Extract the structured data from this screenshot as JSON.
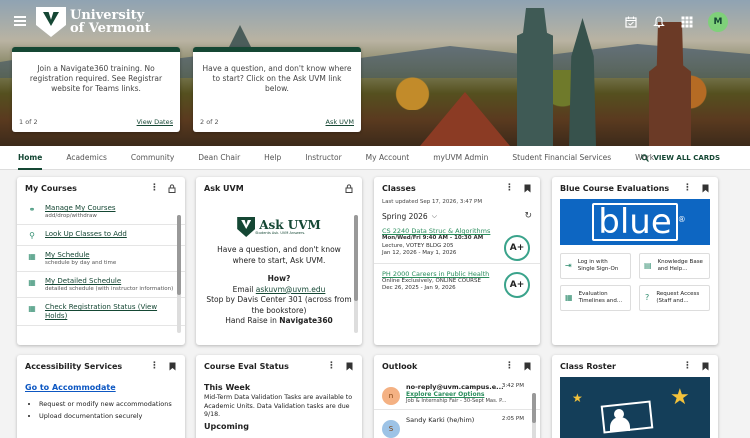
{
  "header": {
    "logo_line1": "University",
    "logo_line2": "of Vermont",
    "avatar_initial": "M"
  },
  "promos": [
    {
      "message": "Join a Navigate360 training. No registration required. See Registrar website for Teams links.",
      "pager": "1 of 2",
      "link": "View Dates"
    },
    {
      "message": "Have a question, and don't know where to start? Click on the Ask UVM link below.",
      "pager": "2 of 2",
      "link": "Ask UVM"
    }
  ],
  "nav": {
    "items": [
      "Home",
      "Academics",
      "Community",
      "Dean Chair",
      "Help",
      "Instructor",
      "My Account",
      "myUVM Admin",
      "Student Financial Services",
      "Work"
    ],
    "view_all": "VIEW ALL CARDS"
  },
  "my_courses": {
    "title": "My Courses",
    "items": [
      {
        "label": "Manage My Courses",
        "sub": "add/drop/withdraw",
        "icon": "share-icon"
      },
      {
        "label": "Look Up Classes to Add",
        "sub": "",
        "icon": "search-icon"
      },
      {
        "label": "My Schedule",
        "sub": "schedule by day and time",
        "icon": "calendar-icon"
      },
      {
        "label": "My Detailed Schedule",
        "sub": "detailed schedule (with instructor information)",
        "icon": "calendar-icon"
      },
      {
        "label": "Check Registration Status (View Holds)",
        "sub": "",
        "icon": "calendar-icon"
      }
    ]
  },
  "ask_uvm": {
    "title": "Ask UVM",
    "logo_name": "Ask UVM",
    "logo_tag": "Students Ask. UVM Answers.",
    "question": "Have a question, and don't know where to start, Ask UVM.",
    "how": "How?",
    "email_label": "Email",
    "email": "askuvm@uvm.edu",
    "stop_by": "Stop by Davis Center 301 (across from the bookstore)",
    "hand_raise": "Hand Raise in",
    "hand_raise_bold": "Navigate360"
  },
  "classes": {
    "title": "Classes",
    "updated": "Last updated Sep 17, 2026, 3:47 PM",
    "term": "Spring 2026",
    "entries": [
      {
        "code": "CS 2240 Data Struc & Algorithms",
        "line1": "Mon/Wed/Fri 9:40 AM - 10:30 AM",
        "line2": "Lecture, VOTEY BLDG 205",
        "line3": "Jan 12, 2026 - May 1, 2026",
        "grade": "A+"
      },
      {
        "code": "PH 2000 Careers in Public Health",
        "line1": "Online Exclusively, ONLINE COURSE",
        "line2": "Dec 26, 2025 - Jan 9, 2026",
        "line3": "",
        "grade": "A+"
      }
    ]
  },
  "blue": {
    "title": "Blue Course Evaluations",
    "banner_word": "blue",
    "tiles": [
      {
        "label": "Log in with Single Sign-On",
        "icon": "login-icon"
      },
      {
        "label": "Knowledge Base and Help...",
        "icon": "book-icon"
      },
      {
        "label": "Evaluation Timelines and...",
        "icon": "calendar-icon"
      },
      {
        "label": "Request Access (Staff and...",
        "icon": "help-icon"
      }
    ]
  },
  "accessibility": {
    "title": "Accessibility Services",
    "link": "Go to Accommodate",
    "items": [
      "Request or modify new accommodations",
      "Upload documentation securely"
    ]
  },
  "course_eval": {
    "title": "Course Eval Status",
    "this_week": "This Week",
    "text": "Mid-Term Data Validation Tasks are available to Academic Units. Data Validation tasks are due 9/18.",
    "upcoming": "Upcoming"
  },
  "outlook": {
    "title": "Outlook",
    "mails": [
      {
        "initial": "n",
        "from": "no-reply@uvm.campus.e...",
        "subject": "Explore Career Options",
        "preview": "Job & Internship Fair - 30-Sept Mas. P...",
        "time": "3:42 PM"
      },
      {
        "initial": "S",
        "from": "Sandy Karki (he/him)",
        "subject": "",
        "preview": "",
        "time": "2:05 PM"
      }
    ]
  },
  "class_roster": {
    "title": "Class Roster"
  }
}
